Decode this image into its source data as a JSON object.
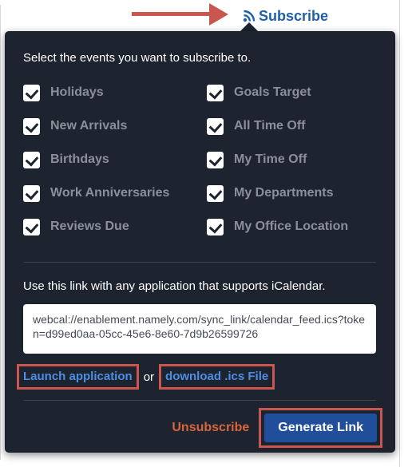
{
  "header": {
    "subscribe_label": "Subscribe",
    "icon": "rss-icon"
  },
  "popover": {
    "intro": "Select the events you want to subscribe to.",
    "events_left": [
      {
        "label": "Holidays",
        "checked": true
      },
      {
        "label": "New Arrivals",
        "checked": true
      },
      {
        "label": "Birthdays",
        "checked": true
      },
      {
        "label": "Work Anniversaries",
        "checked": true
      },
      {
        "label": "Reviews Due",
        "checked": true
      }
    ],
    "events_right": [
      {
        "label": "Goals Target",
        "checked": true
      },
      {
        "label": "All Time Off",
        "checked": true
      },
      {
        "label": "My Time Off",
        "checked": true
      },
      {
        "label": "My Departments",
        "checked": true
      },
      {
        "label": "My Office Location",
        "checked": true
      }
    ],
    "link_hint": "Use this link with any application that supports iCalendar.",
    "feed_url": "webcal://enablement.namely.com/sync_link/calendar_feed.ics?token=d99ed0aa-05cc-45e6-8e60-7d9b26599726",
    "launch_label": "Launch application",
    "or_label": "or",
    "download_label": "download .ics File",
    "unsubscribe_label": "Unsubscribe",
    "generate_label": "Generate Link"
  },
  "colors": {
    "popover_bg": "#1e2330",
    "accent_blue": "#214e9b",
    "link_blue": "#4c8ee6",
    "unsubscribe_orange": "#d9653b",
    "annotation_red": "#c9574f"
  }
}
